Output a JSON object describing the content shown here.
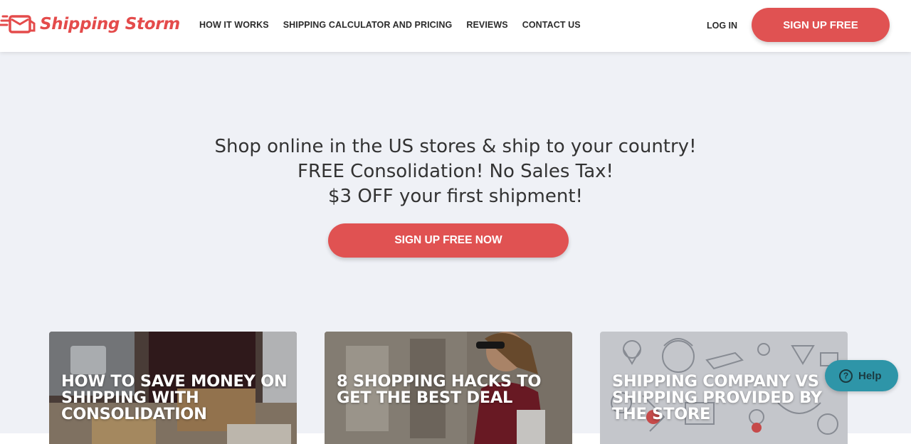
{
  "brand": {
    "name": "Shipping Storm",
    "accent": "#e05252"
  },
  "nav": [
    {
      "label": "HOW IT WORKS"
    },
    {
      "label": "SHIPPING CALCULATOR AND PRICING"
    },
    {
      "label": "REVIEWS"
    },
    {
      "label": "CONTACT US"
    }
  ],
  "header": {
    "login_label": "LOG IN",
    "signup_label": "SIGN UP FREE"
  },
  "hero": {
    "line1": "Shop online in the US stores & ship to your country!",
    "line2": "FREE Consolidation! No Sales Tax!",
    "line3": "$3 OFF your first shipment!",
    "cta_label": "SIGN UP FREE NOW"
  },
  "cards": [
    {
      "title": "HOW TO SAVE MONEY ON SHIPPING WITH CONSOLIDATION"
    },
    {
      "title": "8 SHOPPING HACKS TO GET THE BEST DEAL"
    },
    {
      "title": "SHIPPING COMPANY VS SHIPPING PROVIDED BY THE STORE"
    }
  ],
  "help_widget": {
    "label": "Help",
    "icon": "question-icon",
    "color": "#2e95a8"
  }
}
